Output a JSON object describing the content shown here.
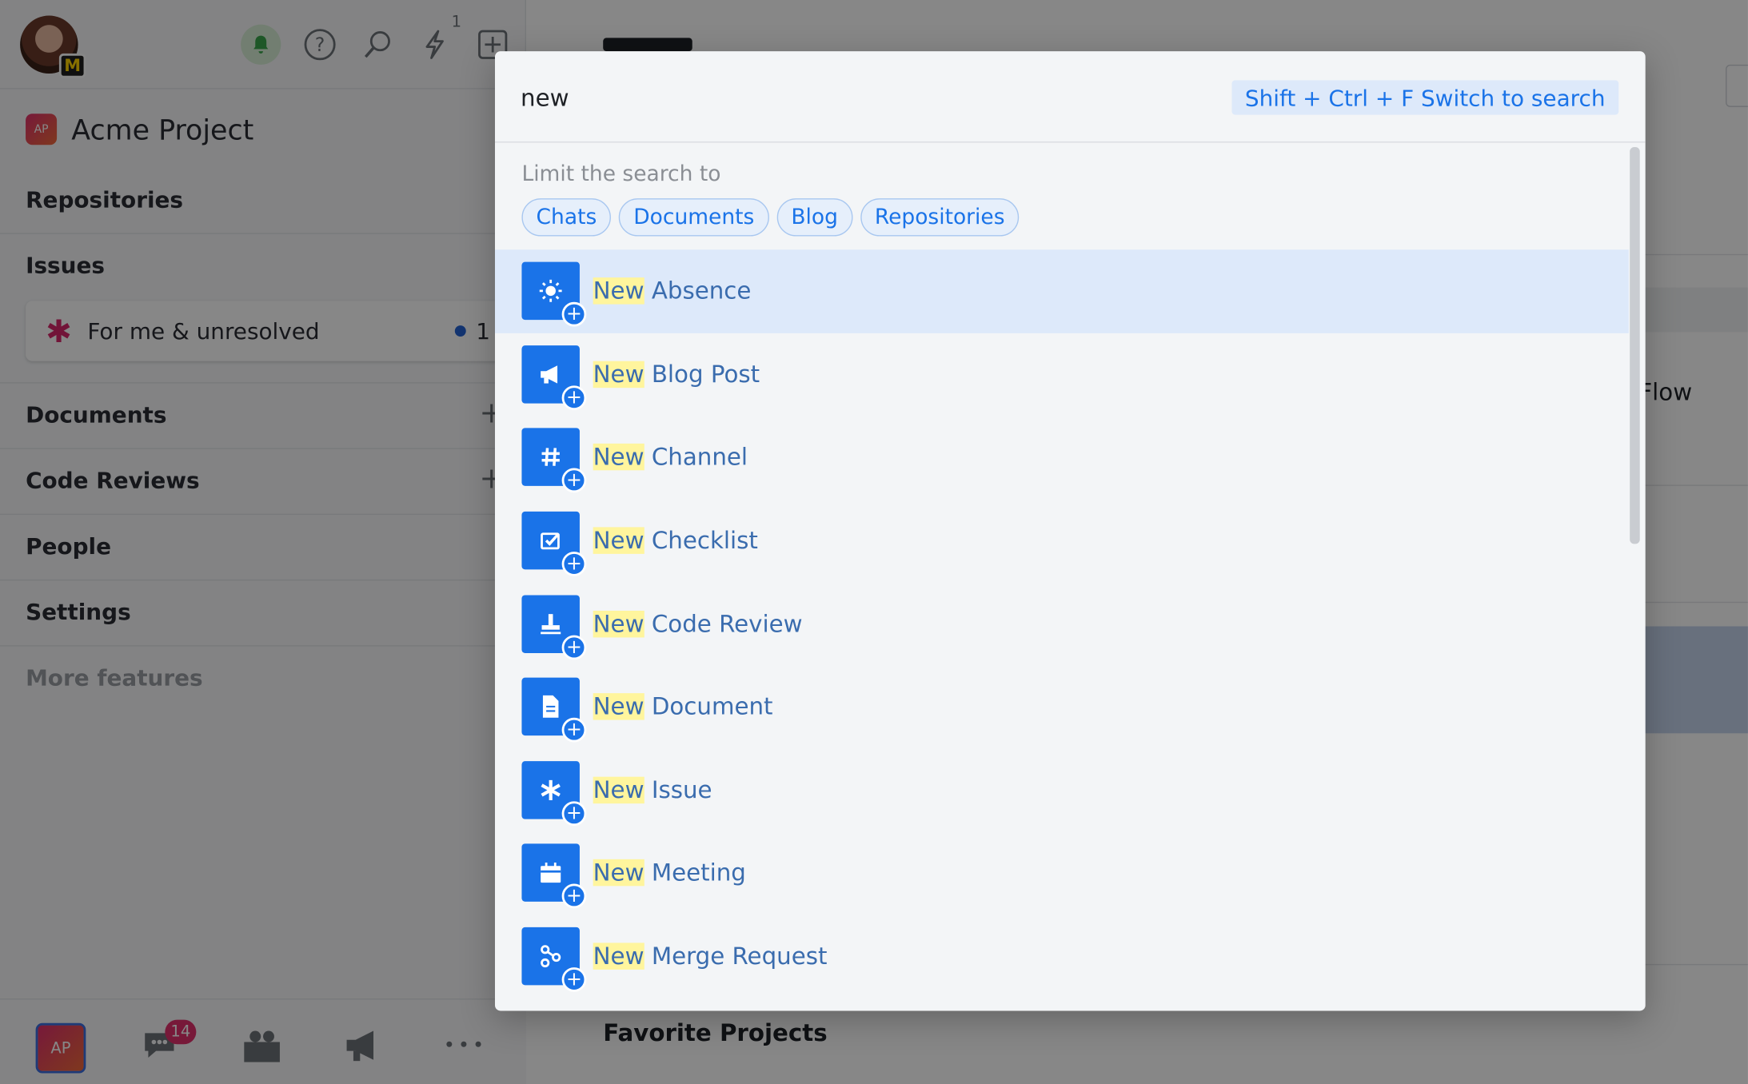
{
  "sidebar": {
    "user_badge": "M",
    "notification_count": "1",
    "project": {
      "badge": "AP",
      "name": "Acme Project"
    },
    "sections": [
      {
        "label": "Repositories",
        "has_add": false
      },
      {
        "label": "Issues",
        "has_add": false
      },
      {
        "label": "Documents",
        "has_add": true
      },
      {
        "label": "Code Reviews",
        "has_add": true
      },
      {
        "label": "People",
        "has_add": false
      },
      {
        "label": "Settings",
        "has_add": false
      }
    ],
    "issue_filter": {
      "label": "For me & unresolved",
      "count": "1"
    },
    "more_features": "More features",
    "bottom": {
      "project_badge": "AP",
      "chat_badge": "14"
    }
  },
  "main": {
    "favorite_projects": "Favorite Projects",
    "flow_text": "Flow"
  },
  "dialog": {
    "query": "new",
    "switch_hint": "Shift + Ctrl + F Switch to search",
    "limit_label": "Limit the search to",
    "chips": [
      "Chats",
      "Documents",
      "Blog",
      "Repositories"
    ],
    "highlight": "New",
    "results": [
      {
        "rest": " Absence",
        "icon": "sun-icon",
        "active": true
      },
      {
        "rest": " Blog Post",
        "icon": "megaphone-icon",
        "active": false
      },
      {
        "rest": " Channel",
        "icon": "hashtag-icon",
        "active": false
      },
      {
        "rest": " Checklist",
        "icon": "checklist-icon",
        "active": false
      },
      {
        "rest": " Code Review",
        "icon": "stamp-icon",
        "active": false
      },
      {
        "rest": " Document",
        "icon": "document-icon",
        "active": false
      },
      {
        "rest": " Issue",
        "icon": "asterisk-icon",
        "active": false
      },
      {
        "rest": " Meeting",
        "icon": "calendar-icon",
        "active": false
      },
      {
        "rest": " Merge Request",
        "icon": "merge-icon",
        "active": false
      }
    ]
  },
  "colors": {
    "accent": "#1a73e8",
    "highlight": "#fff59d",
    "brand_pink": "#e0306d"
  }
}
